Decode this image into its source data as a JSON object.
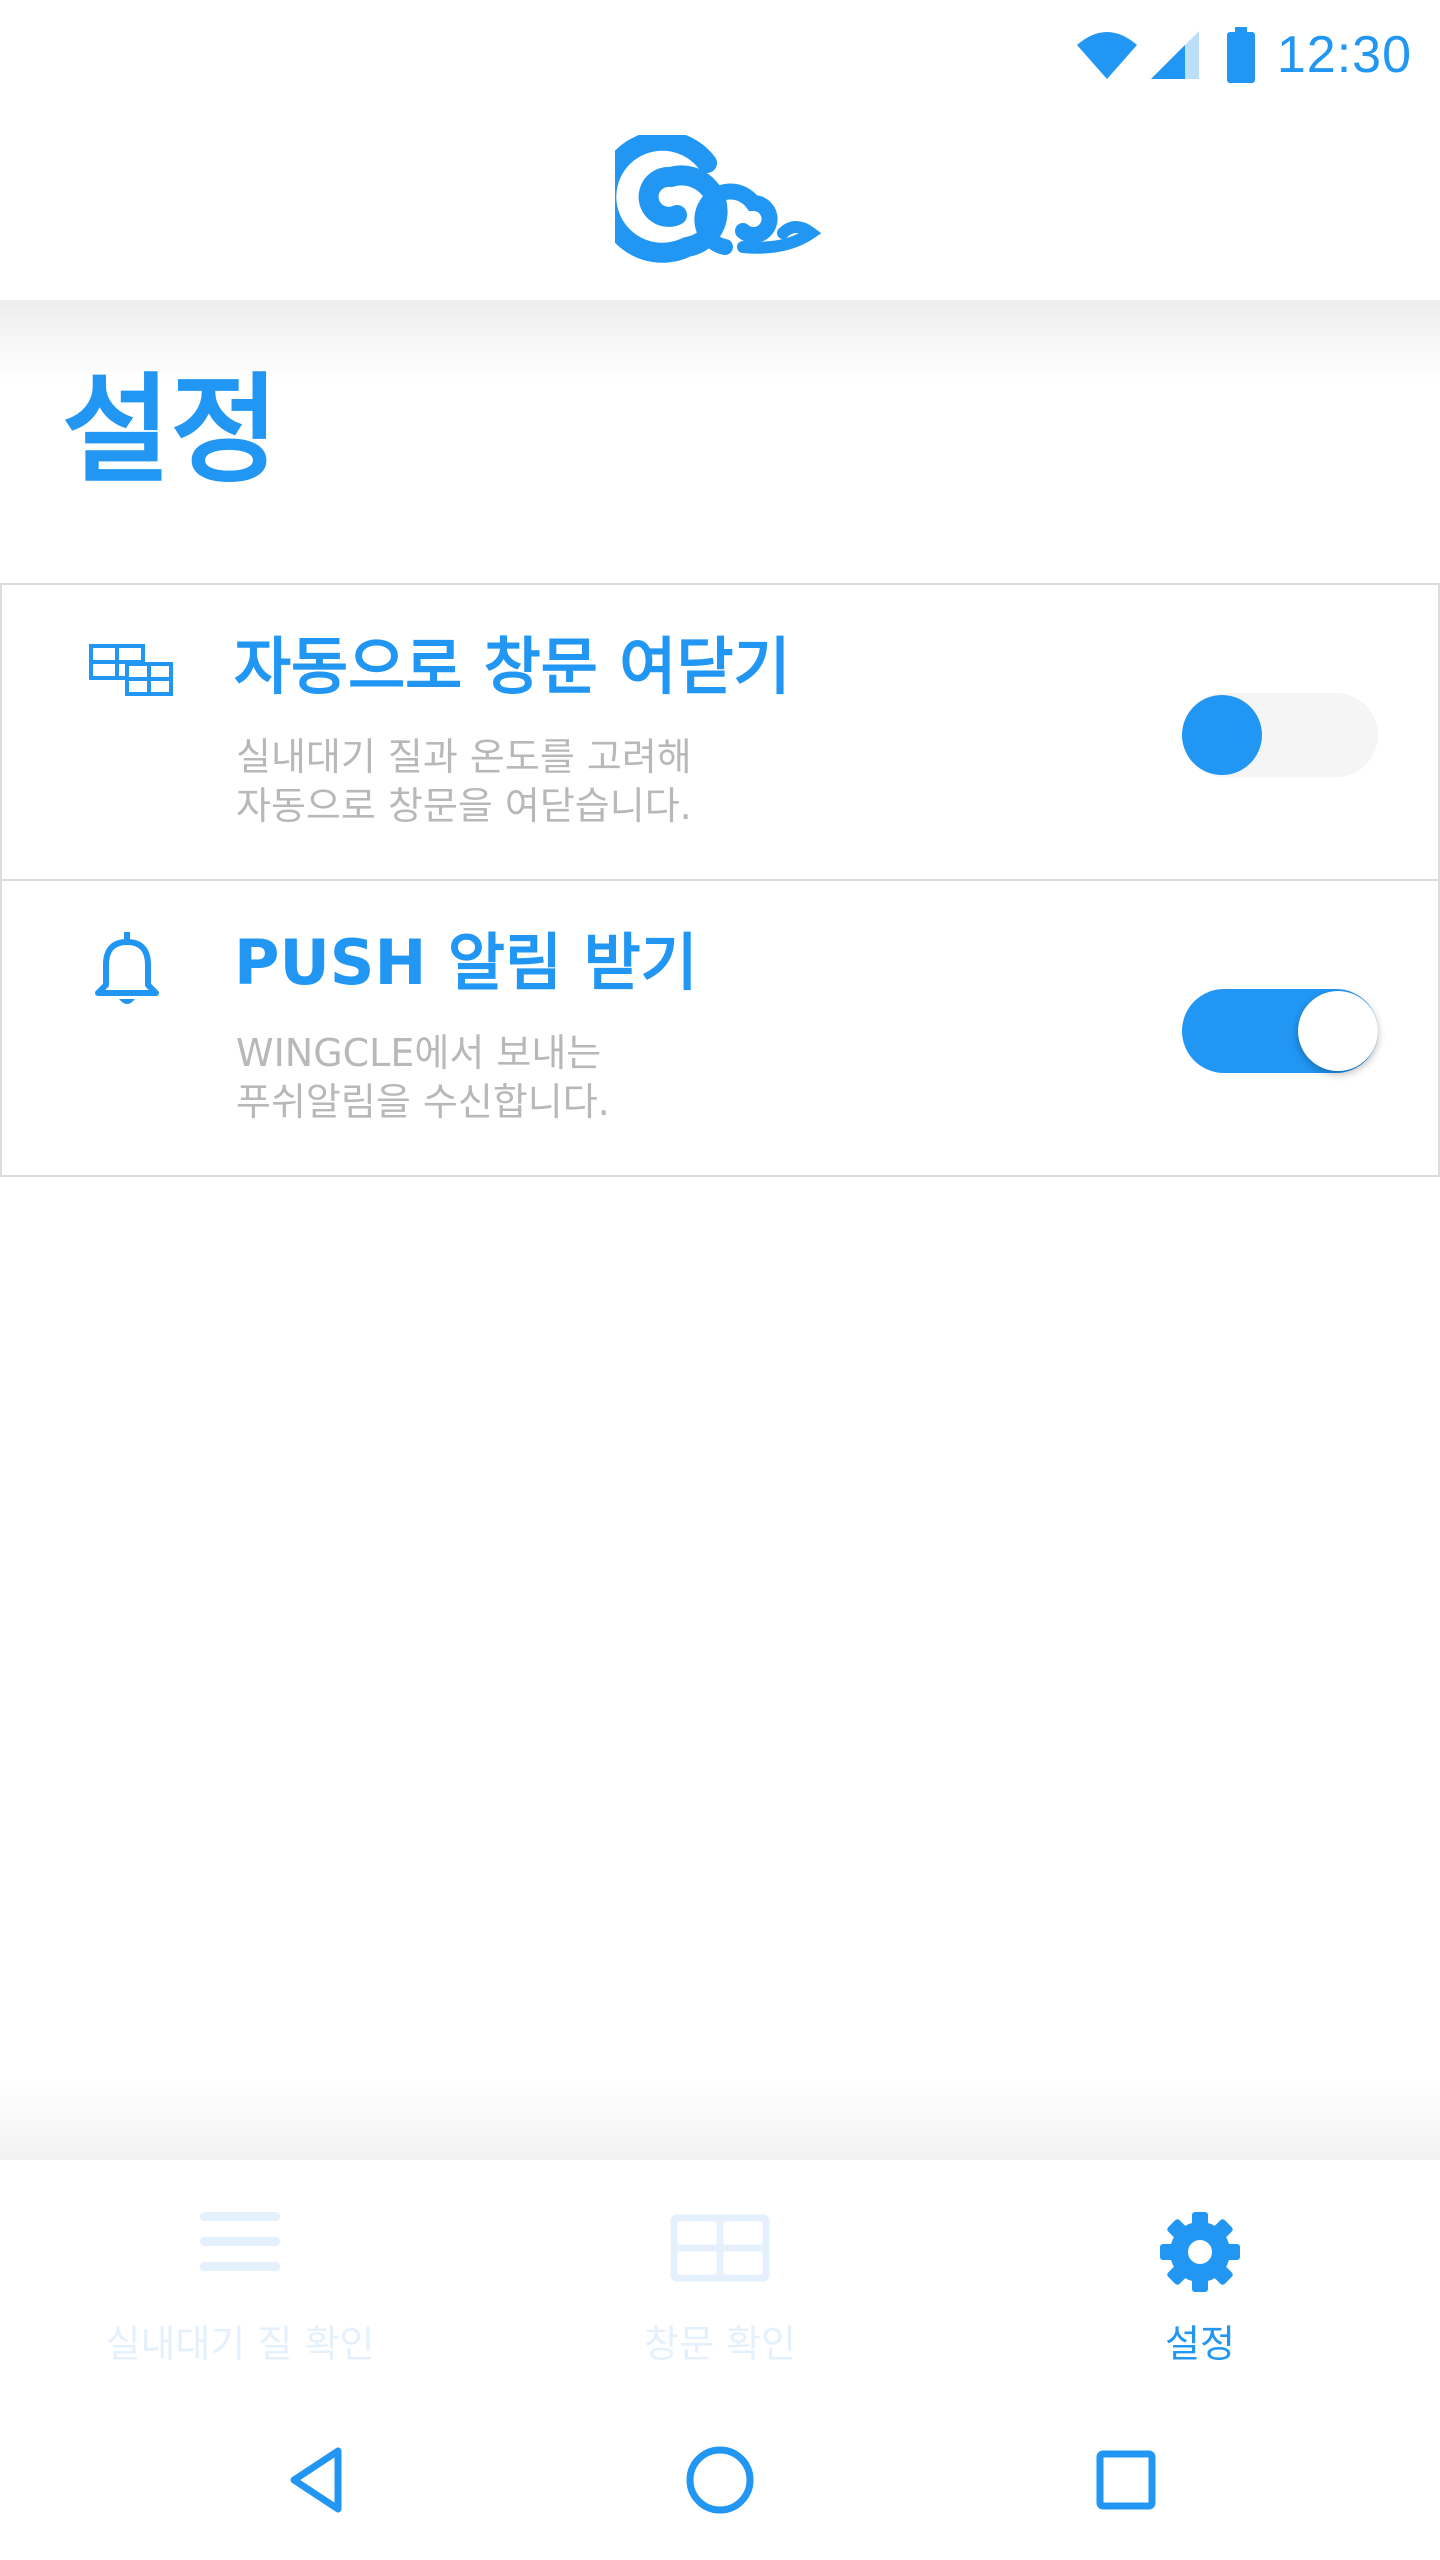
{
  "status_bar": {
    "time": "12:30",
    "icons": [
      "wifi-icon",
      "signal-icon",
      "battery-icon"
    ]
  },
  "header": {
    "logo": "wingcle-logo"
  },
  "page": {
    "title": "설정"
  },
  "settings": [
    {
      "icon": "window-icon",
      "title": "자동으로 창문 여닫기",
      "desc_line1": "실내대기 질과 온도를 고려해",
      "desc_line2": "자동으로 창문을 여닫습니다.",
      "enabled": false
    },
    {
      "icon": "bell-icon",
      "title": "PUSH 알림 받기",
      "desc_line1": "WINGCLE에서 보내는",
      "desc_line2": "푸쉬알림을 수신합니다.",
      "enabled": true
    }
  ],
  "bottom_nav": [
    {
      "icon": "menu-icon",
      "label": "실내대기 질 확인",
      "active": false
    },
    {
      "icon": "window-grid-icon",
      "label": "창문 확인",
      "active": false
    },
    {
      "icon": "gear-icon",
      "label": "설정",
      "active": true
    }
  ],
  "system_nav": [
    "back-icon",
    "home-icon",
    "recents-icon"
  ],
  "colors": {
    "accent": "#2196f3",
    "inactive_nav": "#e4f1fd",
    "description_text": "#b8b8b8",
    "divider": "#dcdcdc"
  }
}
